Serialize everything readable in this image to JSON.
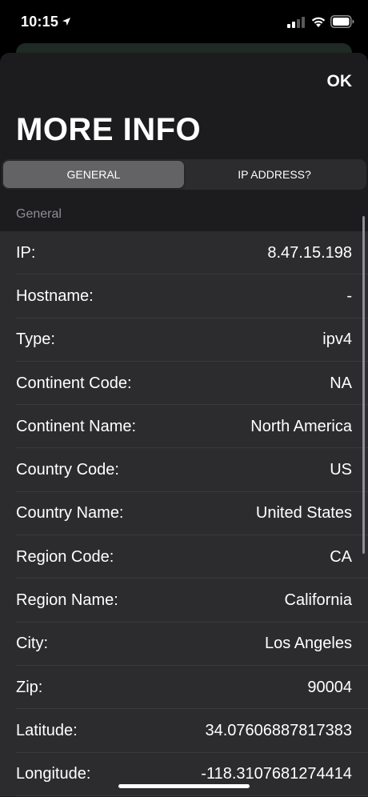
{
  "status_bar": {
    "time": "10:15",
    "location_icon": "location-arrow-icon",
    "signal_icon": "cellular-signal-icon",
    "wifi_icon": "wifi-icon",
    "battery_icon": "battery-icon"
  },
  "sheet": {
    "ok_label": "OK",
    "title": "MORE INFO",
    "tabs": [
      {
        "label": "GENERAL",
        "selected": true
      },
      {
        "label": "IP ADDRESS?",
        "selected": false
      }
    ],
    "section_header": "General",
    "rows": [
      {
        "label": "IP:",
        "value": "8.47.15.198"
      },
      {
        "label": "Hostname:",
        "value": "-"
      },
      {
        "label": "Type:",
        "value": "ipv4"
      },
      {
        "label": "Continent Code:",
        "value": "NA"
      },
      {
        "label": "Continent Name:",
        "value": "North America"
      },
      {
        "label": "Country Code:",
        "value": "US"
      },
      {
        "label": "Country Name:",
        "value": "United States"
      },
      {
        "label": "Region Code:",
        "value": "CA"
      },
      {
        "label": "Region Name:",
        "value": "California"
      },
      {
        "label": "City:",
        "value": "Los Angeles"
      },
      {
        "label": "Zip:",
        "value": "90004"
      },
      {
        "label": "Latitude:",
        "value": "34.07606887817383"
      },
      {
        "label": "Longitude:",
        "value": "-118.3107681274414"
      }
    ]
  },
  "colors": {
    "sheet_background": "#1c1c1e",
    "row_background": "#2c2c2e",
    "selected_segment": "#636366",
    "secondary_text": "#8e8e93"
  }
}
